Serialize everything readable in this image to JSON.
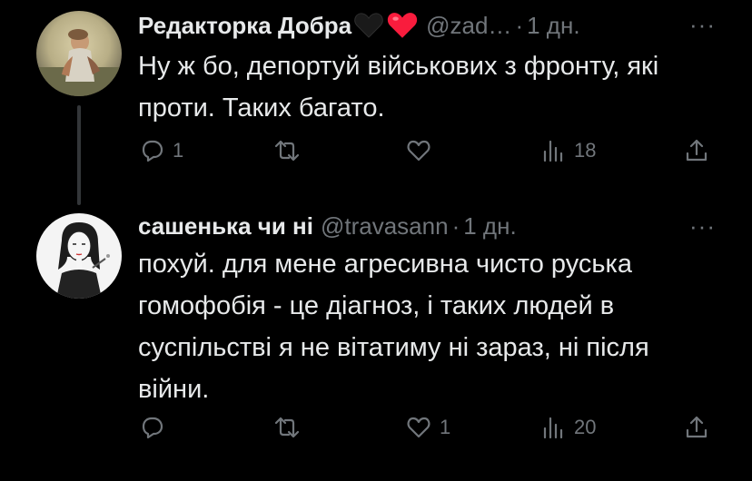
{
  "tweets": [
    {
      "author": "Редакторка Добра",
      "emojis": [
        "black-heart",
        "red-heart"
      ],
      "handle": "@zad…",
      "time": "1 дн.",
      "text": "Ну ж бо, депортуй військових з фронту, які проти. Таких багато.",
      "replies": "1",
      "retweets": "",
      "likes": "",
      "views": "18",
      "more": "···"
    },
    {
      "author": "сашенька чи ні",
      "handle": "@travasann",
      "time": "1 дн.",
      "text": "похуй. для мене агресивна чисто руська гомофобія - це діагноз, і таких людей в суспільстві я не вітатиму ні зараз, ні після війни.",
      "replies": "",
      "retweets": "",
      "likes": "1",
      "views": "20",
      "more": "···"
    }
  ],
  "separator": "·",
  "colors": {
    "background": "#000000",
    "text": "#e7e9ea",
    "secondary": "#71767b",
    "thread_line": "#333639",
    "red_heart": "#f91c3d"
  },
  "icons": [
    "reply-icon",
    "retweet-icon",
    "like-icon",
    "views-icon",
    "share-icon",
    "more-icon"
  ]
}
